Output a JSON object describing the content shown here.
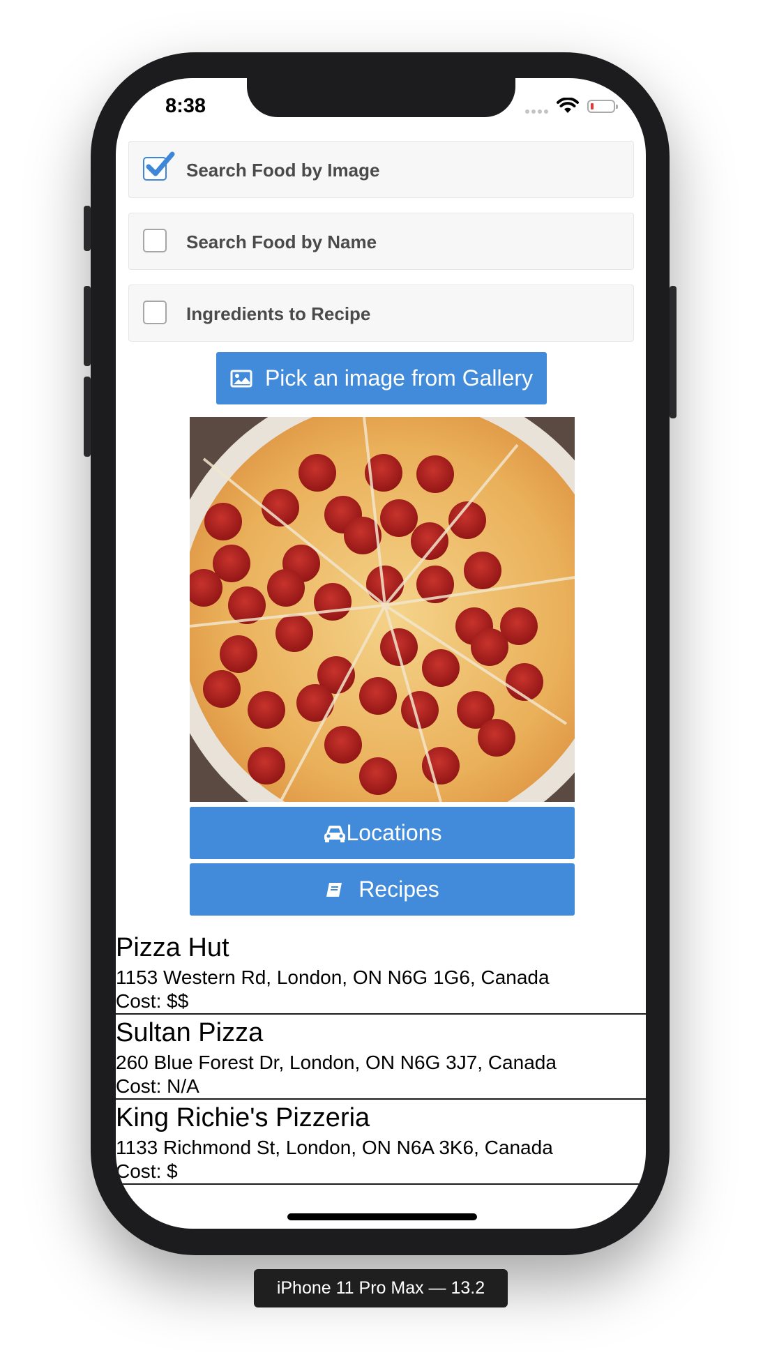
{
  "status_bar": {
    "time": "8:38"
  },
  "options": [
    {
      "label": "Search Food by Image",
      "checked": true
    },
    {
      "label": "Search Food by Name",
      "checked": false
    },
    {
      "label": "Ingredients to Recipe",
      "checked": false
    }
  ],
  "gallery_button": {
    "label": "Pick an image from Gallery",
    "icon": "image-icon"
  },
  "locations_button": {
    "label": "Locations",
    "icon": "car-icon"
  },
  "recipes_button": {
    "label": "Recipes",
    "icon": "book-icon"
  },
  "results": [
    {
      "name": "Pizza Hut",
      "address": "1153 Western Rd, London, ON N6G 1G6, Canada",
      "cost": "Cost: $$"
    },
    {
      "name": "Sultan Pizza",
      "address": "260 Blue Forest Dr, London, ON N6G 3J7, Canada",
      "cost": "Cost: N/A"
    },
    {
      "name": "King Richie's Pizzeria",
      "address": "1133 Richmond St, London, ON N6A 3K6, Canada",
      "cost": "Cost: $"
    }
  ],
  "device_caption": "iPhone 11 Pro Max — 13.2",
  "colors": {
    "accent": "#428bdb",
    "checkbox_checked": "#3e86d6",
    "device": "#1c1c1e"
  }
}
